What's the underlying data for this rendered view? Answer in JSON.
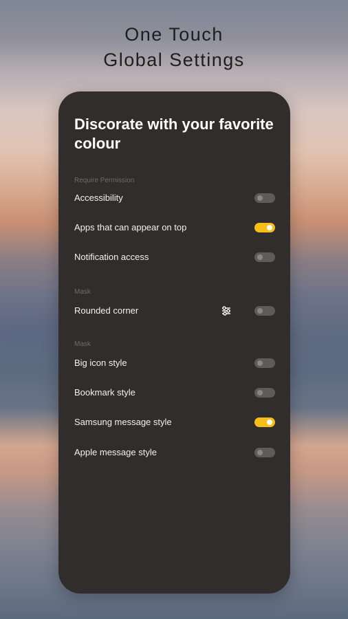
{
  "headline": {
    "line1": "One Touch",
    "line2": "Global Settings"
  },
  "card": {
    "title": "Discorate with your favorite colour"
  },
  "sections": [
    {
      "label": "Require Permission",
      "items": [
        {
          "label": "Accessibility",
          "on": false
        },
        {
          "label": "Apps that can appear on top",
          "on": true
        },
        {
          "label": "Notification access",
          "on": false
        }
      ]
    },
    {
      "label": "Mask",
      "items": [
        {
          "label": "Rounded corner",
          "on": false,
          "icon": "tune-icon"
        }
      ]
    },
    {
      "label": "Mask",
      "items": [
        {
          "label": "Big icon style",
          "on": false
        },
        {
          "label": "Bookmark style",
          "on": false
        },
        {
          "label": "Samsung message style",
          "on": true
        },
        {
          "label": "Apple message style",
          "on": false
        }
      ]
    }
  ],
  "colors": {
    "card_background": "#312d2c",
    "toggle_on": "#f5be18",
    "toggle_off": "#5f5b59"
  }
}
